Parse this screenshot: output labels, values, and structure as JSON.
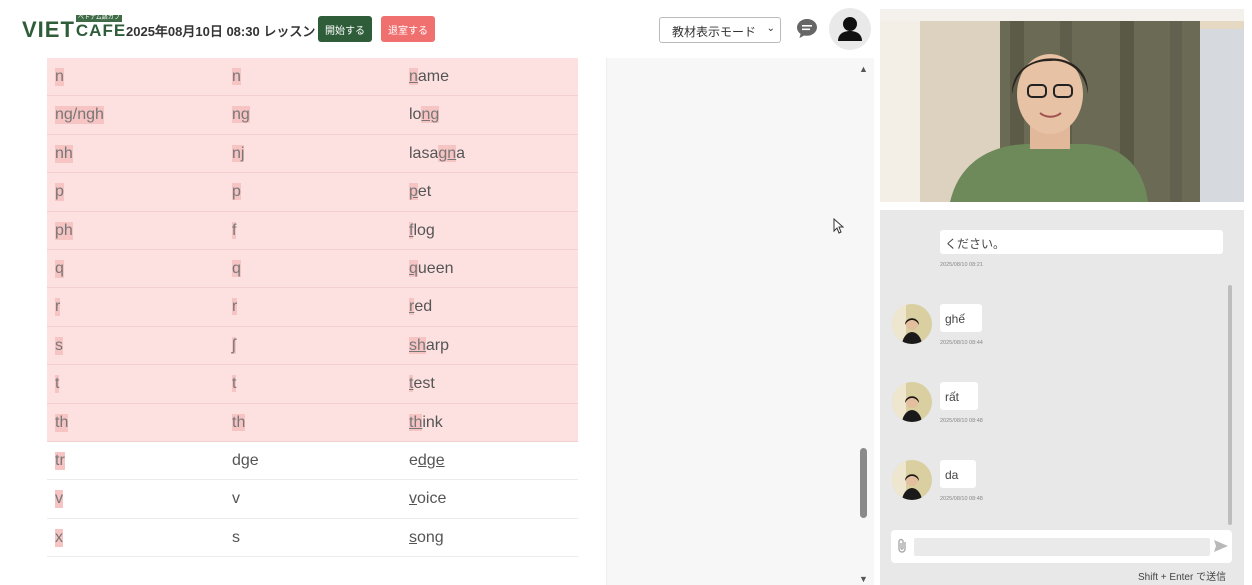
{
  "header": {
    "logo_main": "VIET",
    "logo_sub": "CAFE",
    "logo_tagline": "ベトナム語カフェ",
    "lesson_title": "2025年08月10日 08:30 レッスン",
    "start_button": "開始する",
    "exit_button": "退室する",
    "mode_select": "教材表示モード"
  },
  "pronunciation_table": {
    "rows": [
      {
        "letter": "n",
        "ipa": "n",
        "example_pre": "",
        "example_hl": "n",
        "example_post": "ame",
        "highlight": true
      },
      {
        "letter": "ng/ngh",
        "ipa": "ng",
        "example_pre": "lo",
        "example_hl": "ng",
        "example_post": "",
        "highlight": true
      },
      {
        "letter": "nh",
        "ipa": "nj",
        "example_pre": "lasa",
        "example_hl": "gn",
        "example_post": "a",
        "highlight": true
      },
      {
        "letter": "p",
        "ipa": "p",
        "example_pre": "",
        "example_hl": "p",
        "example_post": "et",
        "highlight": true
      },
      {
        "letter": "ph",
        "ipa": "f",
        "example_pre": "",
        "example_hl": "f",
        "example_post": "log",
        "highlight": true
      },
      {
        "letter": "q",
        "ipa": "q",
        "example_pre": "",
        "example_hl": "q",
        "example_post": "ueen",
        "highlight": true
      },
      {
        "letter": "r",
        "ipa": "r",
        "example_pre": "",
        "example_hl": "r",
        "example_post": "ed",
        "highlight": true
      },
      {
        "letter": "s",
        "ipa": "ʃ",
        "example_pre": "",
        "example_hl": "sh",
        "example_post": "arp",
        "highlight": true
      },
      {
        "letter": "t",
        "ipa": "t",
        "example_pre": "",
        "example_hl": "t",
        "example_post": "est",
        "highlight": true
      },
      {
        "letter": "th",
        "ipa": "th",
        "example_pre": "",
        "example_hl": "th",
        "example_post": "ink",
        "highlight": true
      },
      {
        "letter": "tr",
        "ipa": "dge",
        "example_pre": "e",
        "example_hl": "dge",
        "example_post": "",
        "highlight": false
      },
      {
        "letter": "v",
        "ipa": "v",
        "example_pre": "",
        "example_hl": "v",
        "example_post": "oice",
        "highlight": false
      },
      {
        "letter": "x",
        "ipa": "s",
        "example_pre": "",
        "example_hl": "s",
        "example_post": "ong",
        "highlight": false
      }
    ]
  },
  "chat": {
    "messages": [
      {
        "text": "ください。",
        "time": "2025/08/10 08:21",
        "has_avatar": false
      },
      {
        "text": "ghế",
        "time": "2025/08/10 08:44",
        "has_avatar": true
      },
      {
        "text": "rất",
        "time": "2025/08/10 08:48",
        "has_avatar": true
      },
      {
        "text": "da",
        "time": "2025/08/10 08:48",
        "has_avatar": true
      }
    ],
    "input_placeholder": "",
    "send_hint": "Shift + Enter で送信"
  },
  "icons": {
    "chat_toggle": "chat-bubble-icon",
    "user": "user-avatar-icon",
    "attach": "paperclip-icon",
    "send": "send-icon"
  },
  "colors": {
    "brand_green": "#2f5d3a",
    "exit_red": "#f07070",
    "row_highlight": "#fde0e0",
    "text_highlight": "#f7c4c4"
  }
}
